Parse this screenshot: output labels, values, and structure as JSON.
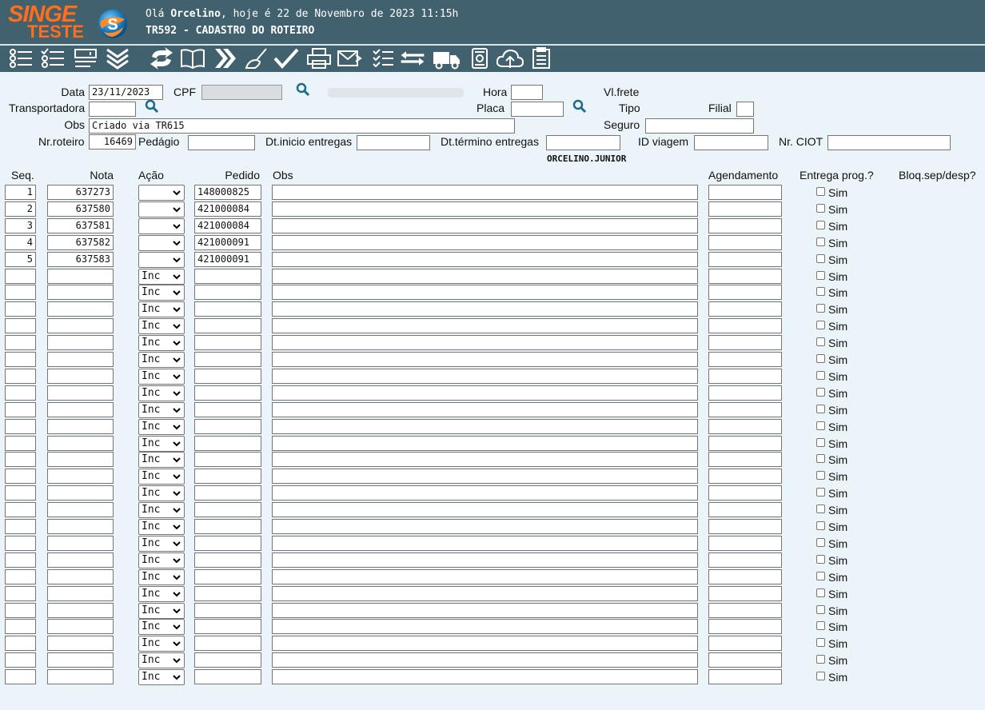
{
  "header": {
    "logo_top": "SINGE",
    "logo_bottom": "TESTE",
    "greeting_prefix": "Olá ",
    "user": "Orcelino",
    "greeting_suffix": ", hoje é 22 de Novembro de 2023 11:15h",
    "title": "TR592 - CADASTRO DO ROTEIRO"
  },
  "toolbar": [
    "list-icon",
    "checklist-icon",
    "form-icon",
    "double-chevron-down-icon",
    "refresh-icon",
    "book-icon",
    "double-chevron-right-icon",
    "broom-icon",
    "check-icon",
    "print-icon",
    "email-icon",
    "tasks-icon",
    "transfer-icon",
    "truck-icon",
    "archive-icon",
    "cloud-upload-icon",
    "clipboard-icon"
  ],
  "form": {
    "data_label": "Data",
    "data_value": "23/11/2023",
    "cpf_label": "CPF",
    "hora_label": "Hora",
    "vl_frete_label": "Vl.frete",
    "transportadora_label": "Transportadora",
    "placa_label": "Placa",
    "tipo_label": "Tipo",
    "filial_label": "Filial",
    "obs_label": "Obs",
    "obs_value": "Criado via TR615",
    "seguro_label": "Seguro",
    "nr_roteiro_label": "Nr.roteiro",
    "nr_roteiro_value": "16469",
    "pedagio_label": "Pedágio",
    "dt_inicio_label": "Dt.inicio entregas",
    "dt_termino_label": "Dt.término entregas",
    "id_viagem_label": "ID viagem",
    "nr_ciot_label": "Nr. CIOT",
    "operator": "ORCELINO.JUNIOR"
  },
  "table": {
    "headers": {
      "seq": "Seq.",
      "nota": "Nota",
      "acao": "Ação",
      "pedido": "Pedido",
      "obs": "Obs",
      "agendamento": "Agendamento",
      "entrega": "Entrega prog.?",
      "bloq": "Bloq.sep/desp?"
    },
    "filled_rows": [
      {
        "seq": "1",
        "nota": "637273",
        "pedido": "148000825"
      },
      {
        "seq": "2",
        "nota": "637580",
        "pedido": "421000084"
      },
      {
        "seq": "3",
        "nota": "637581",
        "pedido": "421000084"
      },
      {
        "seq": "4",
        "nota": "637582",
        "pedido": "421000091"
      },
      {
        "seq": "5",
        "nota": "637583",
        "pedido": "421000091"
      }
    ],
    "empty_row_count": 25,
    "empty_action_value": "Inc",
    "sim_label": "Sim"
  }
}
